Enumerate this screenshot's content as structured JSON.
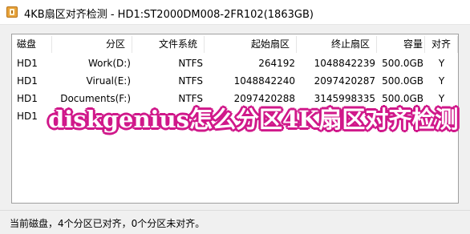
{
  "window": {
    "icon": "diskgenius-app-icon",
    "title": "4KB扇区对齐检测 - HD1:ST2000DM008-2FR102(1863GB)"
  },
  "table": {
    "columns": [
      "磁盘",
      "分区",
      "文件系统",
      "起始扇区",
      "终止扇区",
      "容量",
      "对齐"
    ],
    "rows": [
      [
        "HD1",
        "Work(D:)",
        "NTFS",
        "264192",
        "1048842239",
        "500.0GB",
        "Y"
      ],
      [
        "HD1",
        "Virual(E:)",
        "NTFS",
        "1048842240",
        "2097420287",
        "500.0GB",
        "Y"
      ],
      [
        "HD1",
        "Documents(F:)",
        "NTFS",
        "2097420288",
        "3145998335",
        "500.0GB",
        "Y"
      ],
      [
        "HD1",
        "",
        "",
        "",
        "",
        "",
        "Y"
      ]
    ]
  },
  "overlay": {
    "caption": "diskgenius怎么分区4K扇区对齐检测",
    "text_color": "#ffffff",
    "outline_color": "#d0188a"
  },
  "status": {
    "text": "当前磁盘，4个分区已对齐，0个分区未对齐。"
  }
}
